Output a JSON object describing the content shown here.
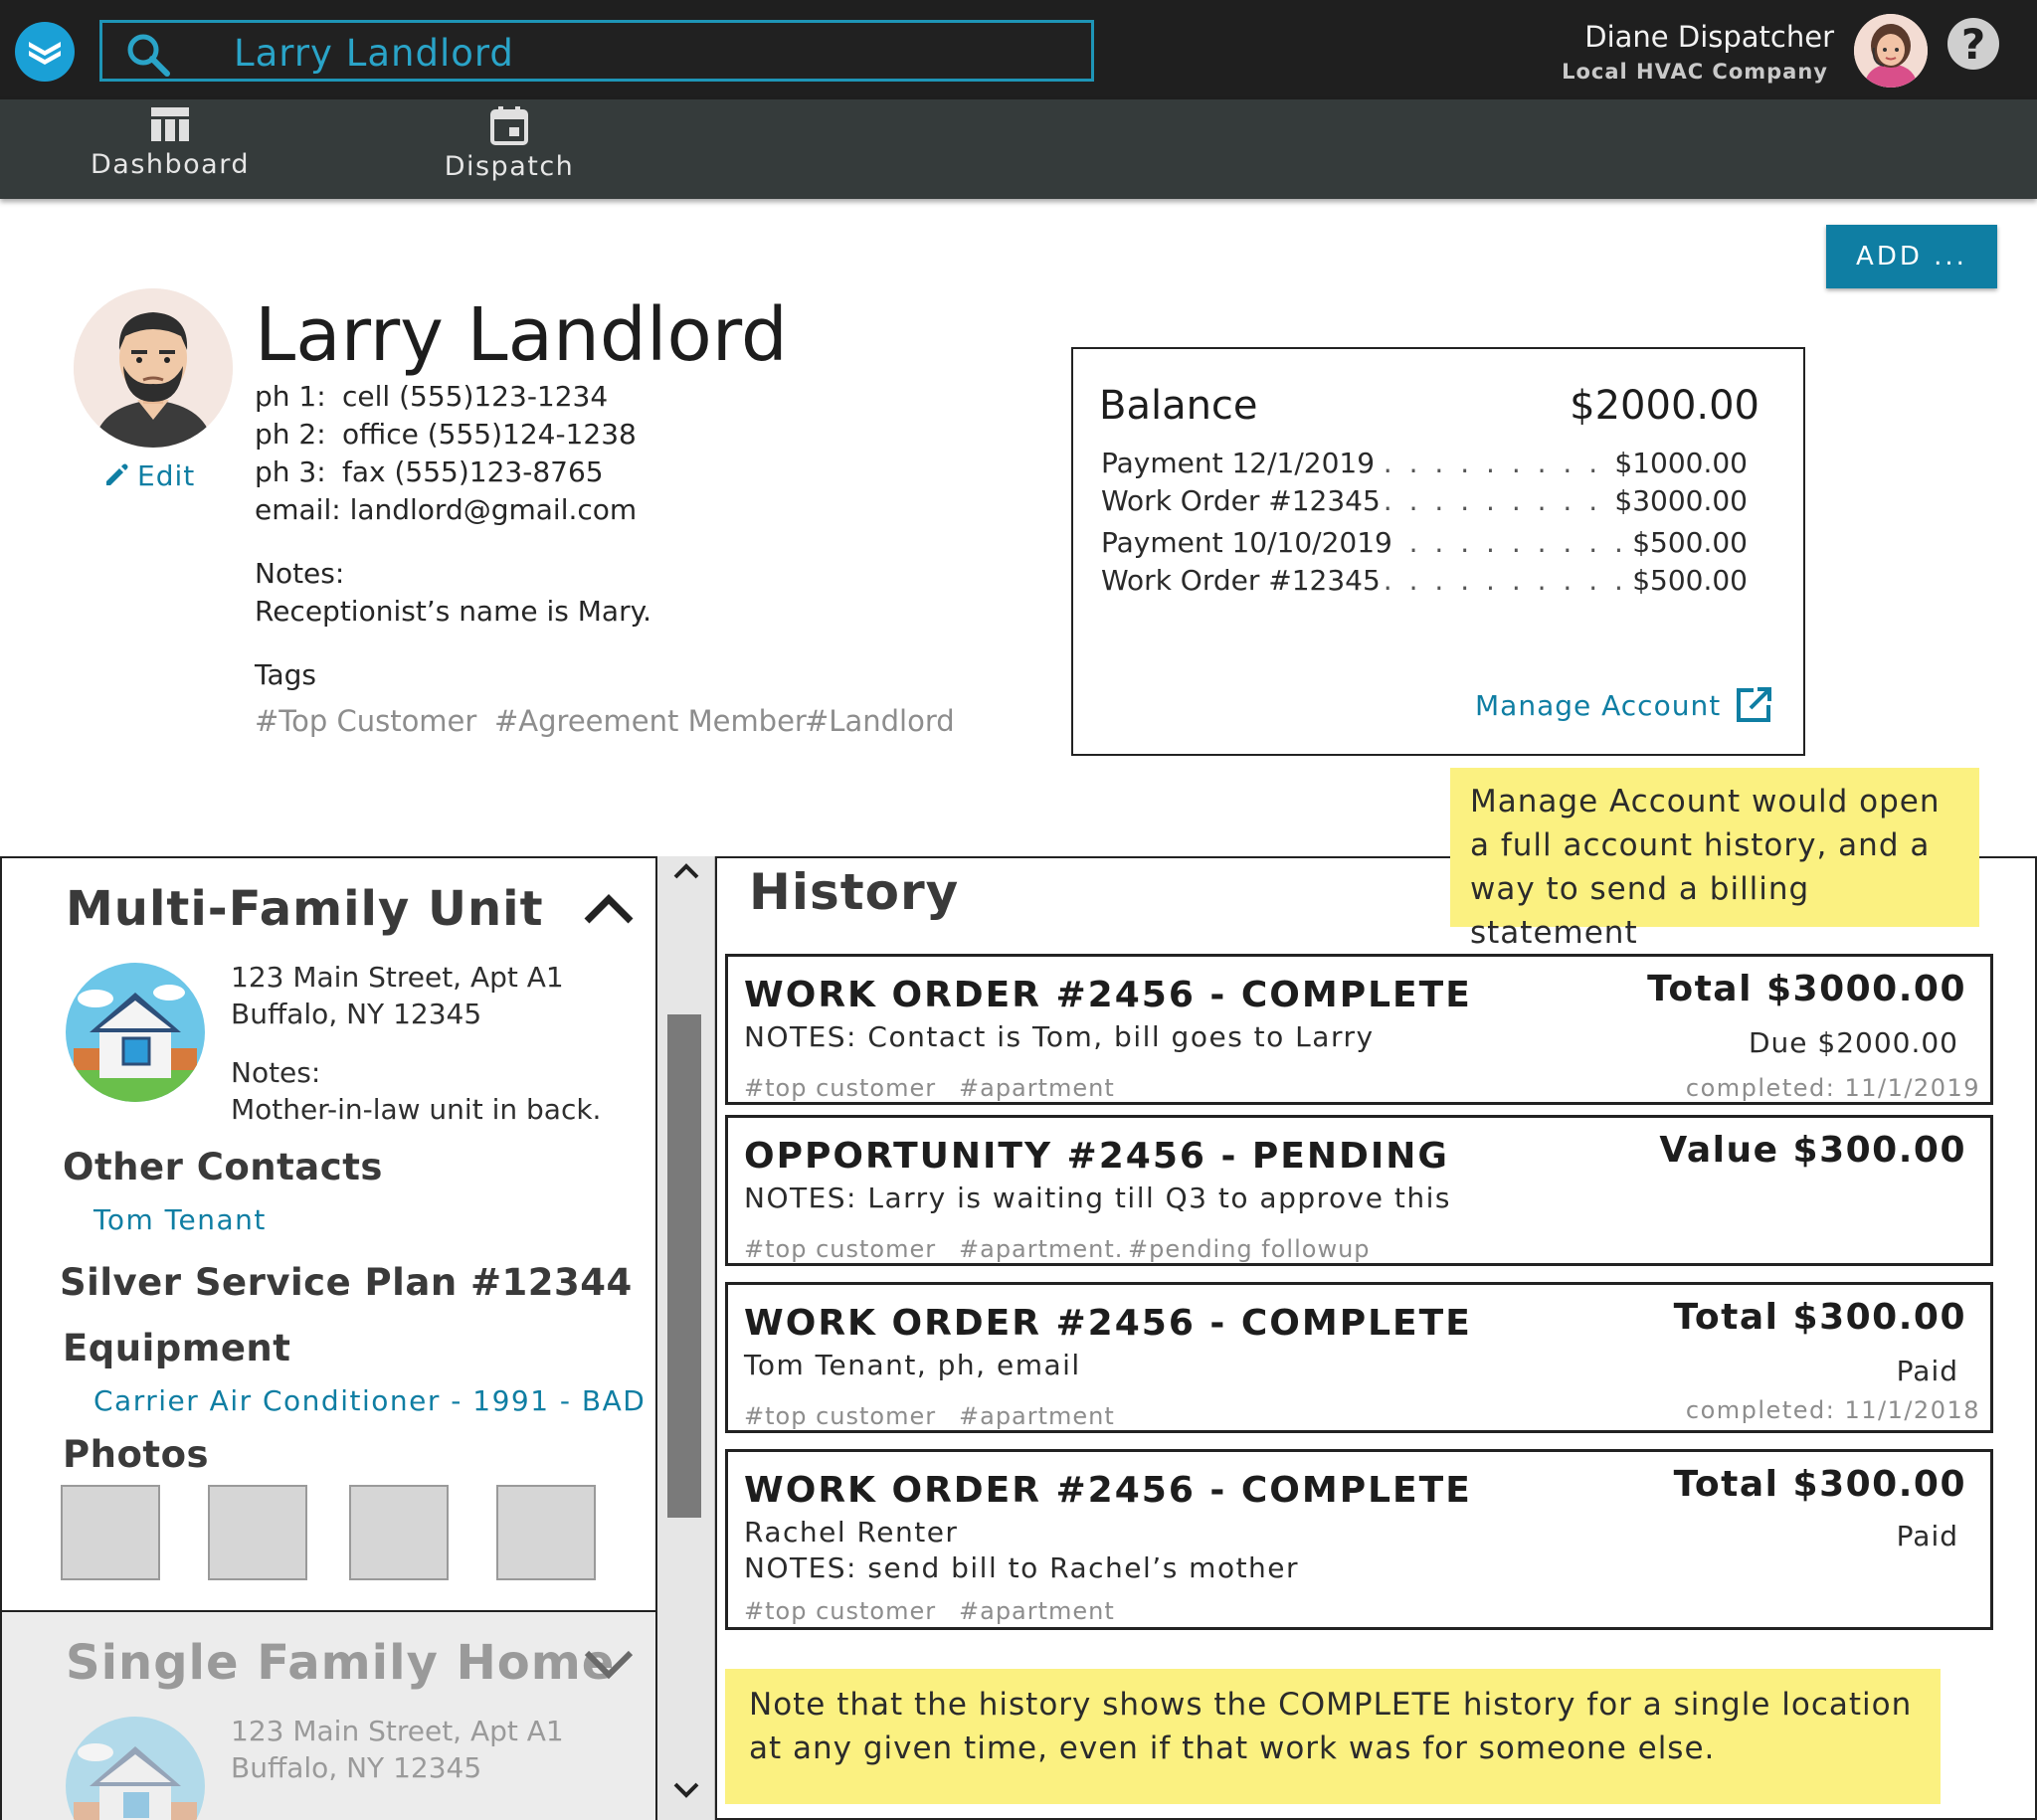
{
  "header": {
    "search_value": "Larry Landlord",
    "user_name": "Diane Dispatcher",
    "user_company": "Local HVAC Company",
    "help_label": "?"
  },
  "nav": {
    "items": [
      {
        "label": "Dashboard",
        "icon": "dashboard-icon"
      },
      {
        "label": "Dispatch",
        "icon": "calendar-icon"
      }
    ]
  },
  "toolbar": {
    "add_label": "ADD ..."
  },
  "customer": {
    "name": "Larry Landlord",
    "edit_label": "Edit",
    "phones": [
      {
        "label": "ph 1:",
        "value": "cell (555)123-1234"
      },
      {
        "label": "ph 2:",
        "value": "office (555)124-1238"
      },
      {
        "label": "ph 3:",
        "value": "fax (555)123-8765"
      }
    ],
    "email_label": "email:",
    "email": "landlord@gmail.com",
    "notes_label": "Notes:",
    "notes": "Receptionist’s name is Mary.",
    "tags_label": "Tags",
    "tags": [
      "#Top Customer",
      "#Agreement Member",
      "#Landlord"
    ]
  },
  "balance": {
    "label": "Balance",
    "amount": "$2000.00",
    "rows": [
      {
        "desc": "Payment 12/1/2019",
        "amount": "$1000.00"
      },
      {
        "desc": "Work Order #12345",
        "amount": "$3000.00"
      },
      {
        "desc": "Payment 10/10/2019",
        "amount": "$500.00"
      },
      {
        "desc": "Work Order #12345",
        "amount": "$500.00"
      }
    ],
    "manage_label": "Manage Account"
  },
  "annotations": {
    "manage_note": "Manage Account would open a full account history, and a way to send a billing statement",
    "history_note": "Note that the history shows the COMPLETE history for a single location at any given time, even if that work was for someone else."
  },
  "locations": [
    {
      "title": "Multi-Family Unit",
      "address_line1": "123 Main Street, Apt A1",
      "address_line2": "Buffalo, NY 12345",
      "notes_label": "Notes:",
      "notes": "Mother-in-law unit in back.",
      "other_contacts_label": "Other Contacts",
      "contacts": [
        "Tom Tenant"
      ],
      "service_plan": "Silver Service Plan #12344",
      "equipment_label": "Equipment",
      "equipment": [
        "Carrier Air Conditioner - 1991 - BAD"
      ],
      "photos_label": "Photos"
    },
    {
      "title": "Single Family Home",
      "address_line1": "123 Main Street, Apt A1",
      "address_line2": "Buffalo, NY 12345"
    }
  ],
  "history": {
    "title": "History",
    "cards": [
      {
        "title": "WORK ORDER #2456 - COMPLETE",
        "lines": [
          "NOTES: Contact is Tom, bill goes to Larry"
        ],
        "amount": "Total $3000.00",
        "status": "Due $2000.00",
        "tags": [
          "#top customer",
          "#apartment"
        ],
        "date": "completed: 11/1/2019"
      },
      {
        "title": "OPPORTUNITY #2456 - PENDING",
        "lines": [
          "NOTES: Larry is waiting till Q3 to approve this"
        ],
        "amount": "Value $300.00",
        "tags": [
          "#top customer",
          "#apartment.",
          "#pending followup"
        ]
      },
      {
        "title": "WORK ORDER #2456 - COMPLETE",
        "lines": [
          "Tom Tenant, ph, email"
        ],
        "amount": "Total $300.00",
        "status": "Paid",
        "tags": [
          "#top customer",
          "#apartment"
        ],
        "date": "completed: 11/1/2018"
      },
      {
        "title": "WORK ORDER #2456 - COMPLETE",
        "lines": [
          "Rachel Renter",
          "NOTES: send bill to Rachel’s mother"
        ],
        "amount": "Total $300.00",
        "status": "Paid",
        "tags": [
          "#top customer",
          "#apartment"
        ]
      }
    ]
  },
  "colors": {
    "accent": "#0f7ea3",
    "topbar": "#1f1f1f",
    "navbar": "#353b3b",
    "sticky": "#fbf181"
  }
}
